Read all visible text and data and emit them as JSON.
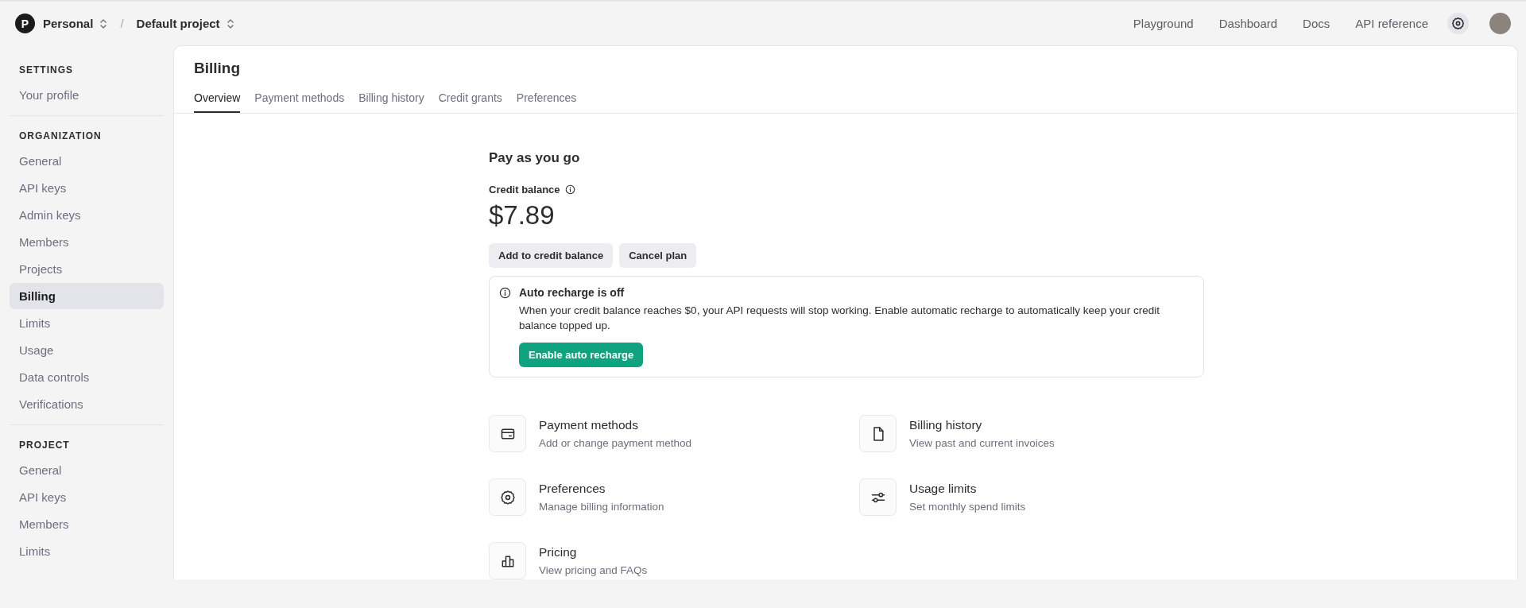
{
  "header": {
    "org": {
      "initial": "P",
      "name": "Personal"
    },
    "separator": "/",
    "project": "Default project",
    "nav": [
      "Playground",
      "Dashboard",
      "Docs",
      "API reference"
    ]
  },
  "sidebar": [
    {
      "title": "SETTINGS",
      "items": [
        {
          "label": "Your profile",
          "selected": false
        }
      ]
    },
    {
      "title": "ORGANIZATION",
      "items": [
        {
          "label": "General",
          "selected": false
        },
        {
          "label": "API keys",
          "selected": false
        },
        {
          "label": "Admin keys",
          "selected": false
        },
        {
          "label": "Members",
          "selected": false
        },
        {
          "label": "Projects",
          "selected": false
        },
        {
          "label": "Billing",
          "selected": true
        },
        {
          "label": "Limits",
          "selected": false
        },
        {
          "label": "Usage",
          "selected": false
        },
        {
          "label": "Data controls",
          "selected": false
        },
        {
          "label": "Verifications",
          "selected": false
        }
      ]
    },
    {
      "title": "PROJECT",
      "items": [
        {
          "label": "General",
          "selected": false
        },
        {
          "label": "API keys",
          "selected": false
        },
        {
          "label": "Members",
          "selected": false
        },
        {
          "label": "Limits",
          "selected": false
        }
      ]
    }
  ],
  "page": {
    "title": "Billing",
    "tabs": [
      {
        "label": "Overview",
        "selected": true
      },
      {
        "label": "Payment methods",
        "selected": false
      },
      {
        "label": "Billing history",
        "selected": false
      },
      {
        "label": "Credit grants",
        "selected": false
      },
      {
        "label": "Preferences",
        "selected": false
      }
    ]
  },
  "plan": {
    "heading": "Pay as you go",
    "balance_label": "Credit balance",
    "balance": "$7.89",
    "buttons": [
      "Add to credit balance",
      "Cancel plan"
    ]
  },
  "alert": {
    "title": "Auto recharge is off",
    "message": "When your credit balance reaches $0, your API requests will stop working. Enable automatic recharge to automatically keep your credit balance topped up.",
    "button": "Enable auto recharge"
  },
  "links": [
    {
      "kind": "card",
      "title": "Payment methods",
      "subtitle": "Add or change payment method"
    },
    {
      "kind": "file",
      "title": "Billing history",
      "subtitle": "View past and current invoices"
    },
    {
      "kind": "gear",
      "title": "Preferences",
      "subtitle": "Manage billing information"
    },
    {
      "kind": "sliders",
      "title": "Usage limits",
      "subtitle": "Set monthly spend limits"
    },
    {
      "kind": "chart",
      "title": "Pricing",
      "subtitle": "View pricing and FAQs"
    }
  ]
}
